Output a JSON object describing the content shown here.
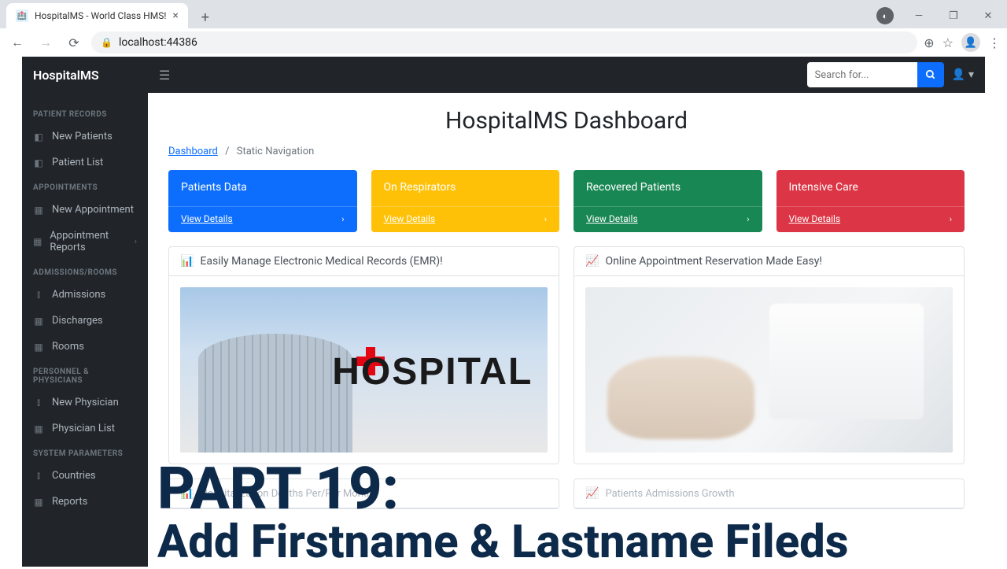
{
  "browser": {
    "tab_title": "HospitalMS - World Class HMS!",
    "url": "localhost:44386"
  },
  "app": {
    "brand": "HospitalMS",
    "search_placeholder": "Search for...",
    "page_title": "HospitalMS Dashboard",
    "breadcrumb_root": "Dashboard",
    "breadcrumb_page": "Static Navigation"
  },
  "sidebar": {
    "s0": {
      "head": "PATIENT RECORDS"
    },
    "s0i0": "New Patients",
    "s0i1": "Patient List",
    "s1": {
      "head": "APPOINTMENTS"
    },
    "s1i0": "New Appointment",
    "s1i1": "Appointment Reports",
    "s2": {
      "head": "ADMISSIONS/ROOMS"
    },
    "s2i0": "Admissions",
    "s2i1": "Discharges",
    "s2i2": "Rooms",
    "s3": {
      "head": "PERSONNEL & PHYSICIANS"
    },
    "s3i0": "New Physician",
    "s3i1": "Physician List",
    "s4": {
      "head": "SYSTEM PARAMETERS"
    },
    "s4i0": "Countries",
    "s4i1": "Reports"
  },
  "cards": {
    "c0": {
      "title": "Patients Data",
      "link": "View Details"
    },
    "c1": {
      "title": "On Respirators",
      "link": "View Details"
    },
    "c2": {
      "title": "Recovered Patients",
      "link": "View Details"
    },
    "c3": {
      "title": "Intensive Care",
      "link": "View Details"
    }
  },
  "panels": {
    "p0": "Easily Manage Electronic Medical Records (EMR)!",
    "p1": "Online Appointment Reservation Made Easy!",
    "p2": "Hospitalization Deaths Per/Per Month",
    "p3": "Patients Admissions Growth"
  },
  "overlay": {
    "line1": "PART 19:",
    "line2": "Add Firstname & Lastname Fileds"
  },
  "hospital_sign": "HOSPITAL"
}
